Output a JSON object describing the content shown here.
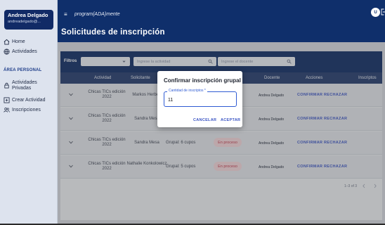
{
  "user": {
    "name": "Andrea Delgado",
    "email": "andreadelgado@..."
  },
  "nav": {
    "home": "Home",
    "activities": "Actividades",
    "section_title": "ÁREA PERSONAL",
    "private_activities": "Actividades Privadas",
    "create_activity": "Crear Actividad",
    "enrollments": "Inscripciones"
  },
  "header": {
    "brand": "program{ADA}mente",
    "page_title": "Solicitudes de inscripción",
    "avatar_initial": "U",
    "menu_glyph": "≡"
  },
  "filters": {
    "label": "Filtros",
    "activity_placeholder": "Ingrese la actividad",
    "teacher_placeholder": "Ingrese el docente"
  },
  "table": {
    "headers": {
      "activity": "Actividad",
      "requester": "Solicitante",
      "teacher": "Docente",
      "actions": "Acciones",
      "enrolled": "Inscriptos"
    },
    "rows": [
      {
        "activity": "Chicas TICs edición 2022",
        "requester": "Markos Herbert",
        "quota": "",
        "status": "",
        "teacher": "Andrea Delgado",
        "confirm": "CONFIRMAR",
        "reject": "RECHAZAR"
      },
      {
        "activity": "Chicas TICs edición 2022",
        "requester": "Sandra Mesa",
        "quota": "",
        "status": "",
        "teacher": "Andrea Delgado",
        "confirm": "CONFIRMAR",
        "reject": "RECHAZAR"
      },
      {
        "activity": "Chicas TICs edición 2022",
        "requester": "Sandra Mesa",
        "quota": "Grupal: 6 cupos",
        "status": "En proceso",
        "teacher": "Andrea Delgado",
        "confirm": "CONFIRMAR",
        "reject": "RECHAZAR"
      },
      {
        "activity": "Chicas TICs edición 2022",
        "requester": "Nathalie Konkolowicz",
        "quota": "Grupal: 5 cupos",
        "status": "En proceso",
        "teacher": "Andrea Delgado",
        "confirm": "CONFIRMAR",
        "reject": "RECHAZAR"
      }
    ],
    "pagination": "1–3 of 3"
  },
  "dialog": {
    "title": "Confirmar inscripción grupal",
    "field_label": "Cantidad de inscriptos *",
    "field_value": "11",
    "cancel": "CANCELAR",
    "accept": "ACEPTAR"
  },
  "colors": {
    "primary": "#0f2f6b",
    "accent": "#3b55c4",
    "status_pending": "#c0394d"
  }
}
